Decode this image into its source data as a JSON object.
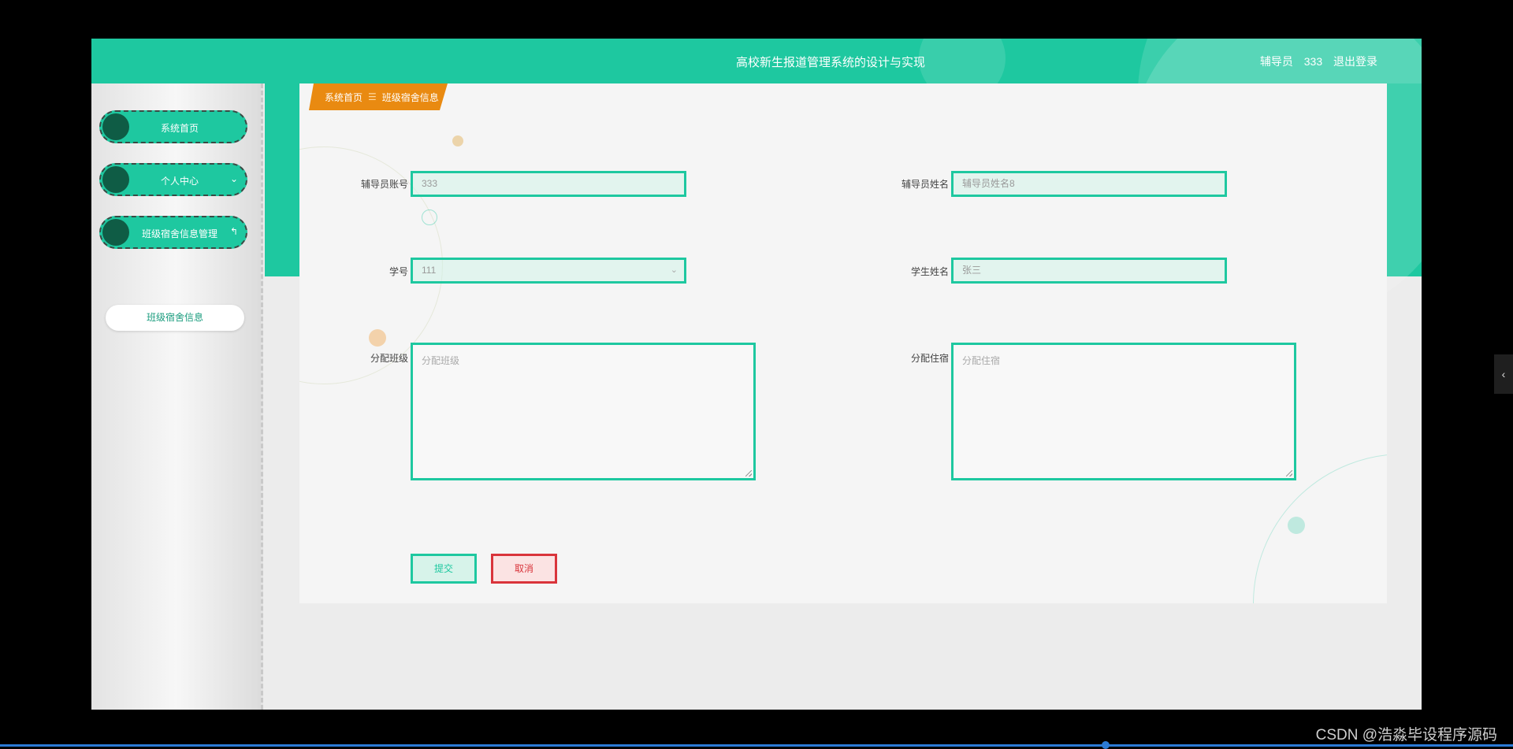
{
  "header": {
    "title": "高校新生报道管理系统的设计与实现",
    "user_role": "辅导员",
    "user_id": "333",
    "logout_label": "退出登录"
  },
  "sidebar": {
    "items": [
      {
        "label": "系统首页"
      },
      {
        "label": "个人中心"
      },
      {
        "label": "班级宿舍信息管理"
      }
    ],
    "sub_item": "班级宿舍信息"
  },
  "breadcrumb": {
    "home": "系统首页",
    "separator": "☰",
    "current": "班级宿舍信息"
  },
  "form": {
    "counselor_account": {
      "label": "辅导员账号",
      "value": "333"
    },
    "counselor_name": {
      "label": "辅导员姓名",
      "value": "辅导员姓名8"
    },
    "student_id": {
      "label": "学号",
      "value": "111"
    },
    "student_name": {
      "label": "学生姓名",
      "value": "张三"
    },
    "assign_class": {
      "label": "分配班级",
      "placeholder": "分配班级"
    },
    "assign_dorm": {
      "label": "分配住宿",
      "placeholder": "分配住宿"
    },
    "submit_label": "提交",
    "cancel_label": "取消"
  },
  "watermark": "CSDN @浩淼毕设程序源码",
  "colors": {
    "primary": "#1ec8a0",
    "breadcrumb": "#e98a11",
    "danger": "#d9343b",
    "menu_ball": "#0f5c45"
  }
}
